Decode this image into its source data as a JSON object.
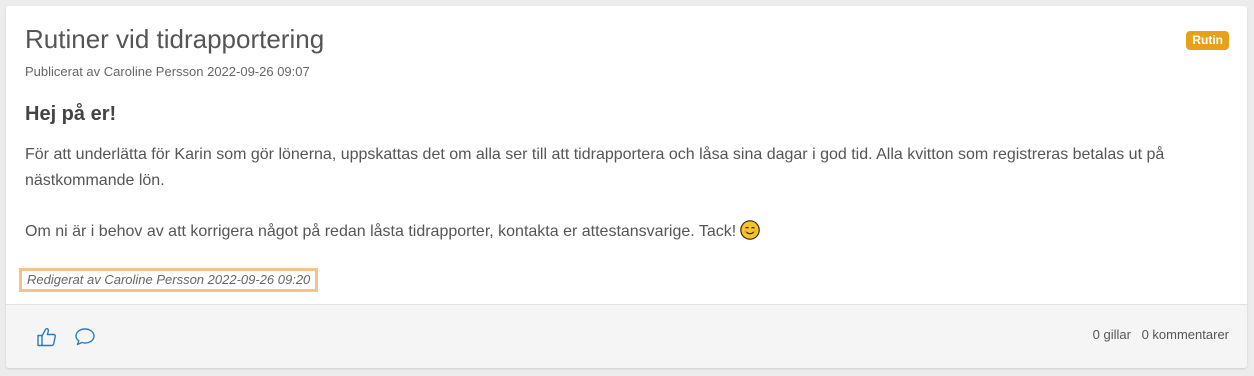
{
  "post": {
    "title": "Rutiner vid tidrapportering",
    "tag": "Rutin",
    "published": "Publicerat av Caroline Persson 2022-09-26 09:07",
    "greeting": "Hej på er!",
    "paragraph1": "För att underlätta för Karin som gör lönerna, uppskattas det om alla ser till att tidrapportera och låsa sina dagar i god tid. Alla kvitton som registreras betalas ut på nästkommande lön.",
    "paragraph2": "Om ni är i behov av att korrigera något på redan låsta tidrapporter, kontakta er attestansvarige. Tack!",
    "emoji": "smiling-face-icon",
    "edited": "Redigerat av Caroline Persson 2022-09-26 09:20"
  },
  "footer": {
    "like_icon": "thumbs-up-icon",
    "comment_icon": "speech-bubble-icon",
    "likes": "0 gillar",
    "comments": "0 kommentarer"
  },
  "colors": {
    "tag_bg": "#e6a118",
    "highlight_border": "#f6c28a",
    "icon_blue": "#2b7bbf"
  }
}
